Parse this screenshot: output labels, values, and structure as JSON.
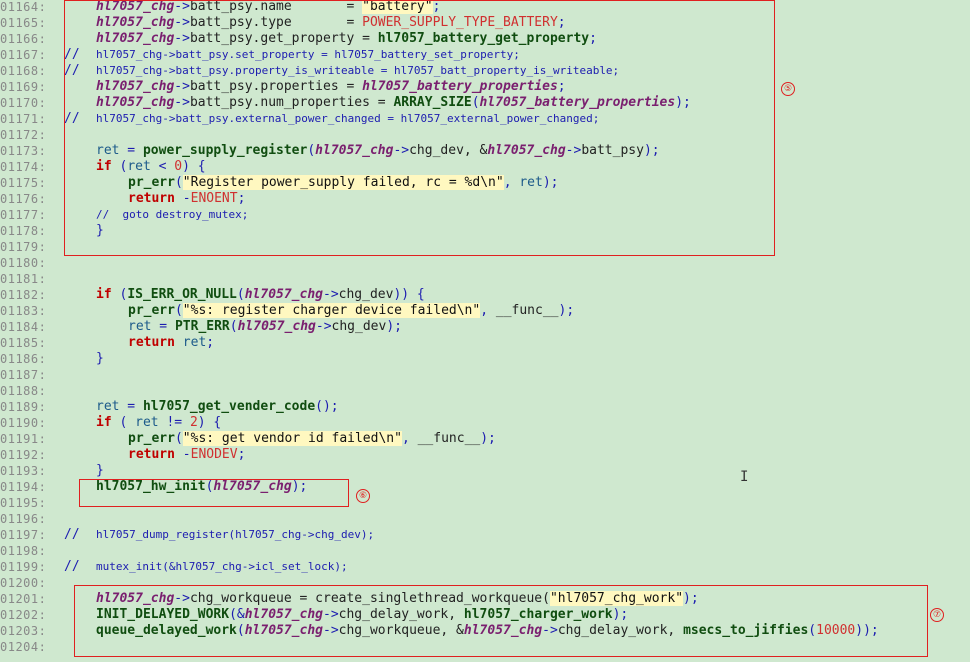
{
  "lines": [
    {
      "num": "01164:",
      "ind": 1,
      "comment": false,
      "tokens": [
        [
          "var",
          "hl7057_chg"
        ],
        [
          "op",
          "->"
        ],
        [
          "plain",
          "batt_psy.name       = "
        ],
        [
          "str",
          "\"battery\""
        ],
        [
          "op",
          ";"
        ]
      ]
    },
    {
      "num": "01165:",
      "ind": 1,
      "comment": false,
      "tokens": [
        [
          "var",
          "hl7057_chg"
        ],
        [
          "op",
          "->"
        ],
        [
          "plain",
          "batt_psy.type       = "
        ],
        [
          "const",
          "POWER_SUPPLY_TYPE_BATTERY"
        ],
        [
          "op",
          ";"
        ]
      ]
    },
    {
      "num": "01166:",
      "ind": 1,
      "comment": false,
      "tokens": [
        [
          "var",
          "hl7057_chg"
        ],
        [
          "op",
          "->"
        ],
        [
          "plain",
          "batt_psy.get_property = "
        ],
        [
          "fn",
          "hl7057_battery_get_property"
        ],
        [
          "op",
          ";"
        ]
      ]
    },
    {
      "num": "01167:",
      "ind": 1,
      "comment": true,
      "tokens": [
        [
          "comment",
          "hl7057_chg->batt_psy.set_property = hl7057_battery_set_property;"
        ]
      ]
    },
    {
      "num": "01168:",
      "ind": 1,
      "comment": true,
      "tokens": [
        [
          "comment",
          "hl7057_chg->batt_psy.property_is_writeable = hl7057_batt_property_is_writeable;"
        ]
      ]
    },
    {
      "num": "01169:",
      "ind": 1,
      "comment": false,
      "tokens": [
        [
          "var",
          "hl7057_chg"
        ],
        [
          "op",
          "->"
        ],
        [
          "plain",
          "batt_psy.properties = "
        ],
        [
          "var",
          "hl7057_battery_properties"
        ],
        [
          "op",
          ";"
        ]
      ]
    },
    {
      "num": "01170:",
      "ind": 1,
      "comment": false,
      "tokens": [
        [
          "var",
          "hl7057_chg"
        ],
        [
          "op",
          "->"
        ],
        [
          "plain",
          "batt_psy.num_properties = "
        ],
        [
          "macro",
          "ARRAY_SIZE"
        ],
        [
          "op",
          "("
        ],
        [
          "var",
          "hl7057_battery_properties"
        ],
        [
          "op",
          ");"
        ]
      ]
    },
    {
      "num": "01171:",
      "ind": 1,
      "comment": true,
      "tokens": [
        [
          "comment",
          "hl7057_chg->batt_psy.external_power_changed = hl7057_external_power_changed;"
        ]
      ]
    },
    {
      "num": "01172:",
      "ind": 0,
      "comment": false,
      "tokens": []
    },
    {
      "num": "01173:",
      "ind": 1,
      "comment": false,
      "tokens": [
        [
          "ident",
          "ret"
        ],
        [
          "op",
          " = "
        ],
        [
          "fn",
          "power_supply_register"
        ],
        [
          "op",
          "("
        ],
        [
          "var",
          "hl7057_chg"
        ],
        [
          "op",
          "->"
        ],
        [
          "plain",
          "chg_dev, &"
        ],
        [
          "var",
          "hl7057_chg"
        ],
        [
          "op",
          "->"
        ],
        [
          "plain",
          "batt_psy"
        ],
        [
          "op",
          ");"
        ]
      ]
    },
    {
      "num": "01174:",
      "ind": 1,
      "comment": false,
      "tokens": [
        [
          "kw",
          "if"
        ],
        [
          "op",
          " ("
        ],
        [
          "ident",
          "ret"
        ],
        [
          "op",
          " < "
        ],
        [
          "num",
          "0"
        ],
        [
          "op",
          ") {"
        ]
      ]
    },
    {
      "num": "01175:",
      "ind": 2,
      "comment": false,
      "tokens": [
        [
          "fn",
          "pr_err"
        ],
        [
          "op",
          "("
        ],
        [
          "str",
          "\"Register power_supply failed, rc = %d\\n\""
        ],
        [
          "op",
          ", "
        ],
        [
          "ident",
          "ret"
        ],
        [
          "op",
          ");"
        ]
      ]
    },
    {
      "num": "01176:",
      "ind": 2,
      "comment": false,
      "tokens": [
        [
          "kw",
          "return"
        ],
        [
          "op",
          " -"
        ],
        [
          "const",
          "ENOENT"
        ],
        [
          "op",
          ";"
        ]
      ]
    },
    {
      "num": "01177:",
      "ind": 1,
      "comment": false,
      "tokens": [
        [
          "comment",
          "//  goto destroy_mutex;"
        ]
      ]
    },
    {
      "num": "01178:",
      "ind": 1,
      "comment": false,
      "tokens": [
        [
          "op",
          "}"
        ]
      ]
    },
    {
      "num": "01179:",
      "ind": 0,
      "comment": false,
      "tokens": []
    },
    {
      "num": "01180:",
      "ind": 0,
      "comment": false,
      "tokens": []
    },
    {
      "num": "01181:",
      "ind": 0,
      "comment": false,
      "tokens": []
    },
    {
      "num": "01182:",
      "ind": 1,
      "comment": false,
      "tokens": [
        [
          "kw",
          "if"
        ],
        [
          "op",
          " ("
        ],
        [
          "macro",
          "IS_ERR_OR_NULL"
        ],
        [
          "op",
          "("
        ],
        [
          "var",
          "hl7057_chg"
        ],
        [
          "op",
          "->"
        ],
        [
          "plain",
          "chg_dev"
        ],
        [
          "op",
          ")) {"
        ]
      ]
    },
    {
      "num": "01183:",
      "ind": 2,
      "comment": false,
      "tokens": [
        [
          "fn",
          "pr_err"
        ],
        [
          "op",
          "("
        ],
        [
          "str",
          "\"%s: register charger device failed\\n\""
        ],
        [
          "op",
          ", "
        ],
        [
          "plain",
          "__func__"
        ],
        [
          "op",
          ");"
        ]
      ]
    },
    {
      "num": "01184:",
      "ind": 2,
      "comment": false,
      "tokens": [
        [
          "ident",
          "ret"
        ],
        [
          "op",
          " = "
        ],
        [
          "macro",
          "PTR_ERR"
        ],
        [
          "op",
          "("
        ],
        [
          "var",
          "hl7057_chg"
        ],
        [
          "op",
          "->"
        ],
        [
          "plain",
          "chg_dev"
        ],
        [
          "op",
          ");"
        ]
      ]
    },
    {
      "num": "01185:",
      "ind": 2,
      "comment": false,
      "tokens": [
        [
          "kw",
          "return"
        ],
        [
          "op",
          " "
        ],
        [
          "ident",
          "ret"
        ],
        [
          "op",
          ";"
        ]
      ]
    },
    {
      "num": "01186:",
      "ind": 1,
      "comment": false,
      "tokens": [
        [
          "op",
          "}"
        ]
      ]
    },
    {
      "num": "01187:",
      "ind": 0,
      "comment": false,
      "tokens": []
    },
    {
      "num": "01188:",
      "ind": 0,
      "comment": false,
      "tokens": []
    },
    {
      "num": "01189:",
      "ind": 1,
      "comment": false,
      "tokens": [
        [
          "ident",
          "ret"
        ],
        [
          "op",
          " = "
        ],
        [
          "fn",
          "hl7057_get_vender_code"
        ],
        [
          "op",
          "();"
        ]
      ]
    },
    {
      "num": "01190:",
      "ind": 1,
      "comment": false,
      "tokens": [
        [
          "kw",
          "if"
        ],
        [
          "op",
          " ( "
        ],
        [
          "ident",
          "ret"
        ],
        [
          "op",
          " != "
        ],
        [
          "num",
          "2"
        ],
        [
          "op",
          ") {"
        ]
      ]
    },
    {
      "num": "01191:",
      "ind": 2,
      "comment": false,
      "tokens": [
        [
          "fn",
          "pr_err"
        ],
        [
          "op",
          "("
        ],
        [
          "str",
          "\"%s: get vendor id failed\\n\""
        ],
        [
          "op",
          ", "
        ],
        [
          "plain",
          "__func__"
        ],
        [
          "op",
          ");"
        ]
      ]
    },
    {
      "num": "01192:",
      "ind": 2,
      "comment": false,
      "tokens": [
        [
          "kw",
          "return"
        ],
        [
          "op",
          " -"
        ],
        [
          "const",
          "ENODEV"
        ],
        [
          "op",
          ";"
        ]
      ]
    },
    {
      "num": "01193:",
      "ind": 1,
      "comment": false,
      "tokens": [
        [
          "op",
          "}"
        ]
      ]
    },
    {
      "num": "01194:",
      "ind": 1,
      "comment": false,
      "tokens": [
        [
          "fn",
          "hl7057_hw_init"
        ],
        [
          "op",
          "("
        ],
        [
          "var",
          "hl7057_chg"
        ],
        [
          "op",
          ");"
        ]
      ]
    },
    {
      "num": "01195:",
      "ind": 0,
      "comment": false,
      "tokens": []
    },
    {
      "num": "01196:",
      "ind": 0,
      "comment": false,
      "tokens": []
    },
    {
      "num": "01197:",
      "ind": 1,
      "comment": true,
      "tokens": [
        [
          "comment",
          "hl7057_dump_register(hl7057_chg->chg_dev);"
        ]
      ]
    },
    {
      "num": "01198:",
      "ind": 0,
      "comment": false,
      "tokens": []
    },
    {
      "num": "01199:",
      "ind": 1,
      "comment": true,
      "tokens": [
        [
          "comment",
          "mutex_init(&hl7057_chg->icl_set_lock);"
        ]
      ]
    },
    {
      "num": "01200:",
      "ind": 0,
      "comment": false,
      "tokens": []
    },
    {
      "num": "01201:",
      "ind": 1,
      "comment": false,
      "tokens": [
        [
          "var",
          "hl7057_chg"
        ],
        [
          "op",
          "->"
        ],
        [
          "plain",
          "chg_workqueue = create_singlethread_workqueue("
        ],
        [
          "str",
          "\"hl7057_chg_work\""
        ],
        [
          "op",
          ");"
        ]
      ]
    },
    {
      "num": "01202:",
      "ind": 1,
      "comment": false,
      "tokens": [
        [
          "macro",
          "INIT_DELAYED_WORK"
        ],
        [
          "op",
          "(&"
        ],
        [
          "var",
          "hl7057_chg"
        ],
        [
          "op",
          "->"
        ],
        [
          "plain",
          "chg_delay_work, "
        ],
        [
          "fn",
          "hl7057_charger_work"
        ],
        [
          "op",
          ");"
        ]
      ]
    },
    {
      "num": "01203:",
      "ind": 1,
      "comment": false,
      "tokens": [
        [
          "fn",
          "queue_delayed_work"
        ],
        [
          "op",
          "("
        ],
        [
          "var",
          "hl7057_chg"
        ],
        [
          "op",
          "->"
        ],
        [
          "plain",
          "chg_workqueue, &"
        ],
        [
          "var",
          "hl7057_chg"
        ],
        [
          "op",
          "->"
        ],
        [
          "plain",
          "chg_delay_work, "
        ],
        [
          "fn",
          "msecs_to_jiffies"
        ],
        [
          "op",
          "("
        ],
        [
          "num",
          "10000"
        ],
        [
          "op",
          "));"
        ]
      ]
    },
    {
      "num": "01204:",
      "ind": 0,
      "comment": false,
      "tokens": []
    }
  ],
  "comment_marker": "//",
  "annotations": {
    "box5_label": "⑤",
    "box6_label": "⑥",
    "box7_label": "⑦"
  },
  "cursor_glyph": "I"
}
